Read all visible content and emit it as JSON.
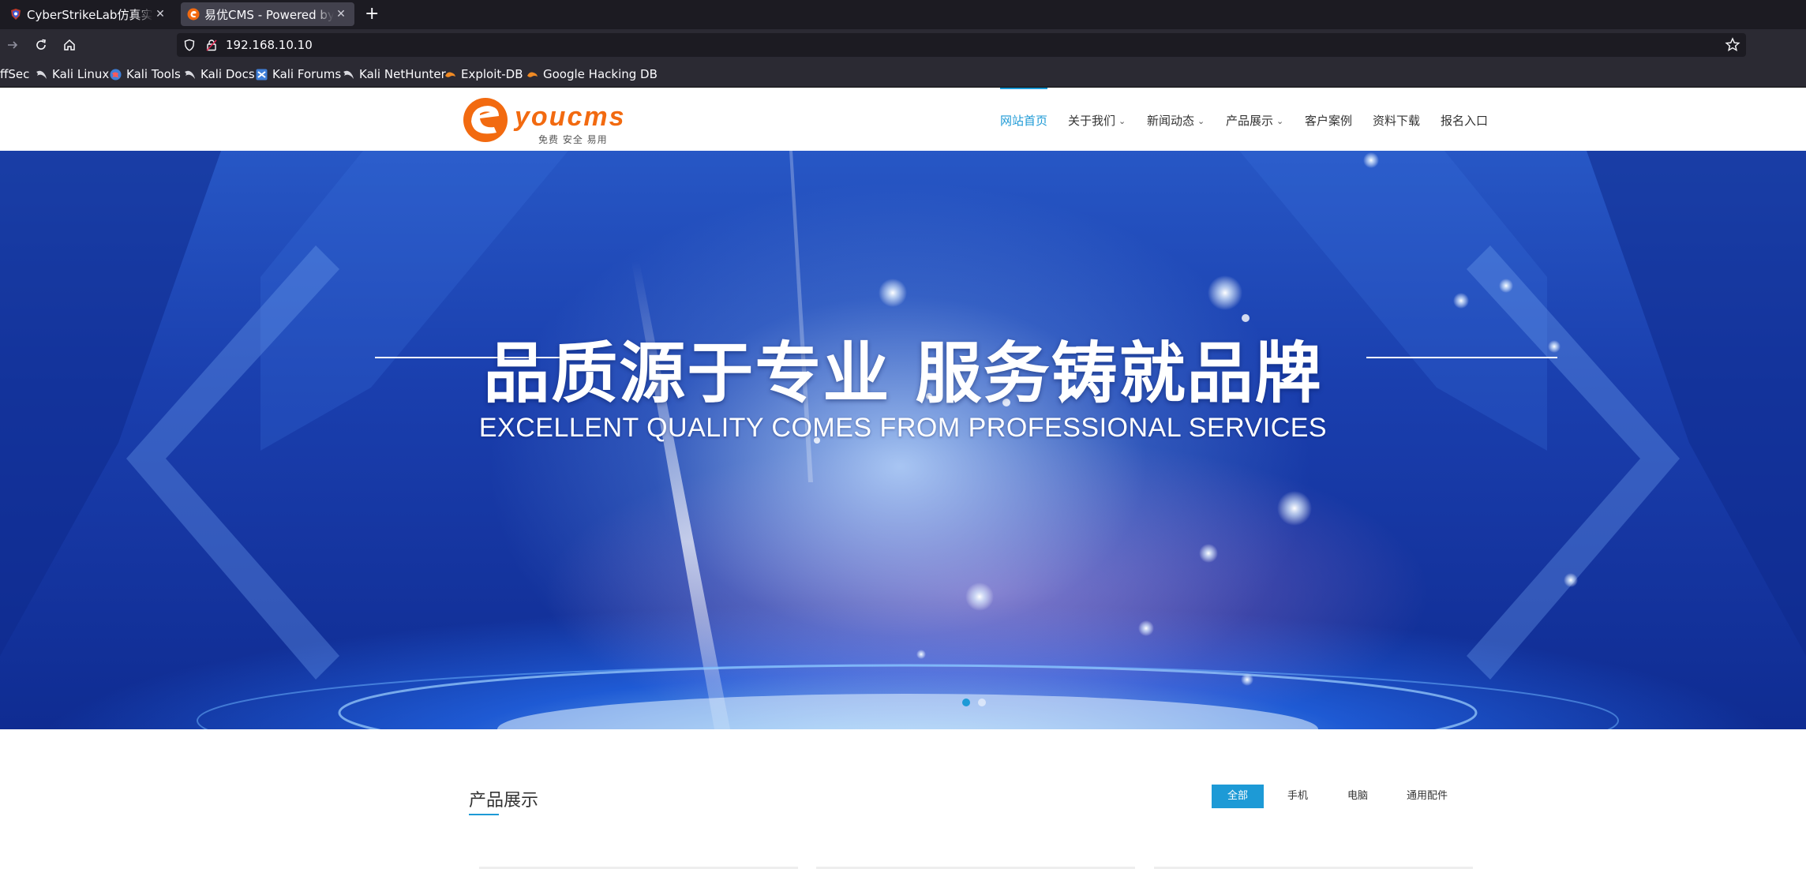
{
  "browser": {
    "tabs": [
      {
        "title": "CyberStrikeLab仿真实战平",
        "active": false
      },
      {
        "title": "易优CMS - Powered by Ey",
        "active": true
      }
    ],
    "address": "192.168.10.10",
    "bookmarks": [
      "ffSec",
      "Kali Linux",
      "Kali Tools",
      "Kali Docs",
      "Kali Forums",
      "Kali NetHunter",
      "Exploit-DB",
      "Google Hacking DB"
    ]
  },
  "site": {
    "logo_text": "youcms",
    "logo_tagline": "免费  安全  易用",
    "menu": [
      {
        "label": "网站首页",
        "active": true,
        "dropdown": false
      },
      {
        "label": "关于我们",
        "active": false,
        "dropdown": true
      },
      {
        "label": "新闻动态",
        "active": false,
        "dropdown": true
      },
      {
        "label": "产品展示",
        "active": false,
        "dropdown": true
      },
      {
        "label": "客户案例",
        "active": false,
        "dropdown": false
      },
      {
        "label": "资料下载",
        "active": false,
        "dropdown": false
      },
      {
        "label": "报名入口",
        "active": false,
        "dropdown": false
      }
    ]
  },
  "banner": {
    "headline": "品质源于专业 服务铸就品牌",
    "subheadline": "EXCELLENT QUALITY COMES FROM PROFESSIONAL SERVICES",
    "slide_count": 2,
    "active_slide": 1
  },
  "products": {
    "title": "产品展示",
    "filters": [
      {
        "label": "全部",
        "active": true
      },
      {
        "label": "手机",
        "active": false
      },
      {
        "label": "电脑",
        "active": false
      },
      {
        "label": "通用配件",
        "active": false
      }
    ]
  },
  "colors": {
    "accent": "#1d9ad6",
    "logo_orange": "#f26a10",
    "chrome_dark": "#1c1b22",
    "chrome_toolbar": "#2b2a33"
  }
}
